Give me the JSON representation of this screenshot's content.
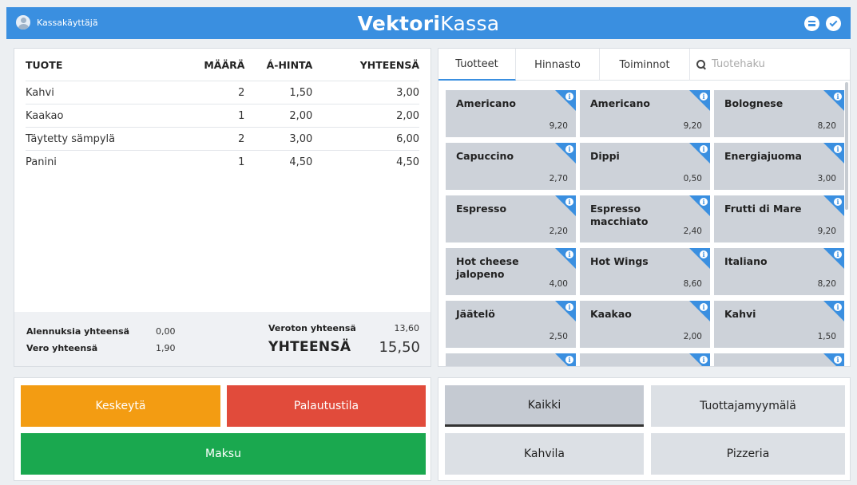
{
  "header": {
    "user": "Kassakäyttäjä",
    "brand_bold": "Vektori",
    "brand_light": "Kassa"
  },
  "receipt": {
    "columns": {
      "name": "TUOTE",
      "qty": "MÄÄRÄ",
      "unit": "Á-HINTA",
      "total": "YHTEENSÄ"
    },
    "rows": [
      {
        "name": "Kahvi",
        "qty": "2",
        "unit": "1,50",
        "total": "3,00"
      },
      {
        "name": "Kaakao",
        "qty": "1",
        "unit": "2,00",
        "total": "2,00"
      },
      {
        "name": "Täytetty sämpylä",
        "qty": "2",
        "unit": "3,00",
        "total": "6,00"
      },
      {
        "name": "Panini",
        "qty": "1",
        "unit": "4,50",
        "total": "4,50"
      }
    ],
    "summary": {
      "discounts_label": "Alennuksia yhteensä",
      "discounts_value": "0,00",
      "tax_label": "Vero yhteensä",
      "tax_value": "1,90",
      "net_label": "Veroton yhteensä",
      "net_value": "13,60",
      "total_label": "YHTEENSÄ",
      "total_value": "15,50"
    }
  },
  "actions": {
    "pause": "Keskeytä",
    "refund": "Palautustila",
    "pay": "Maksu"
  },
  "products": {
    "tabs": [
      "Tuotteet",
      "Hinnasto",
      "Toiminnot"
    ],
    "search_placeholder": "Tuotehaku",
    "items": [
      {
        "name": "Americano",
        "price": "9,20"
      },
      {
        "name": "Americano",
        "price": "9,20"
      },
      {
        "name": "Bolognese",
        "price": "8,20"
      },
      {
        "name": "Capuccino",
        "price": "2,70"
      },
      {
        "name": "Dippi",
        "price": "0,50"
      },
      {
        "name": "Energiajuoma",
        "price": "3,00"
      },
      {
        "name": "Espresso",
        "price": "2,20"
      },
      {
        "name": "Espresso macchiato",
        "price": "2,40"
      },
      {
        "name": "Frutti di Mare",
        "price": "9,20"
      },
      {
        "name": "Hot cheese jalopeno",
        "price": "4,00"
      },
      {
        "name": "Hot Wings",
        "price": "8,60"
      },
      {
        "name": "Italiano",
        "price": "8,20"
      },
      {
        "name": "Jäätelö",
        "price": "2,50"
      },
      {
        "name": "Kaakao",
        "price": "2,00"
      },
      {
        "name": "Kahvi",
        "price": "1,50"
      },
      {
        "name": "",
        "price": ""
      },
      {
        "name": "",
        "price": ""
      },
      {
        "name": "",
        "price": ""
      }
    ]
  },
  "categories": [
    "Kaikki",
    "Tuottajamyymälä",
    "Kahvila",
    "Pizzeria"
  ],
  "colors": {
    "header": "#3a8fe0",
    "pause": "#f39c12",
    "refund": "#e14b3b",
    "pay": "#1aa84f",
    "tile": "#cdd2d9"
  }
}
